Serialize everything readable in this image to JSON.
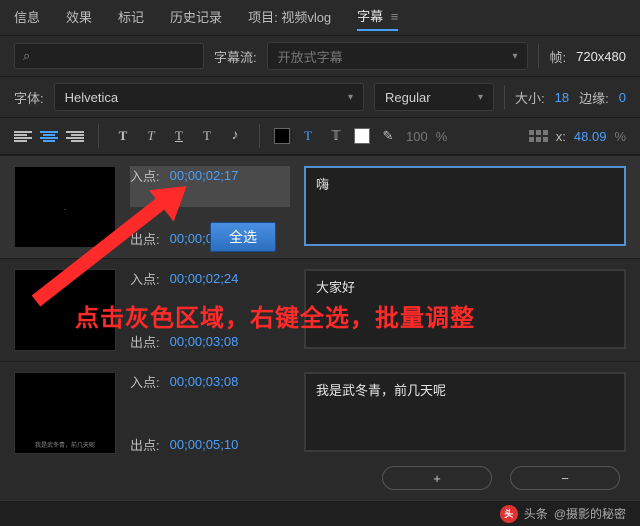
{
  "tabs": {
    "info": "信息",
    "effects": "效果",
    "markers": "标记",
    "history": "历史记录",
    "project_prefix": "项目:",
    "project_name": "视频vlog",
    "captions": "字幕"
  },
  "search": {
    "icon": "⌕"
  },
  "stream_row": {
    "label": "字幕流:",
    "value": "开放式字幕",
    "frame_label": "帧:",
    "frame_value": "720x480"
  },
  "font_row": {
    "label": "字体:",
    "family": "Helvetica",
    "weight": "Regular",
    "size_label": "大小:",
    "size_value": "18",
    "edge_label": "边缘:",
    "edge_value": "0"
  },
  "toolbar": {
    "bold": "T",
    "italic": "T",
    "underline": "T",
    "outline": "T",
    "fill_T": "T",
    "opacity_value": "100",
    "pct": "%",
    "x_label": "x:",
    "x_value": "48.09",
    "x_pct": "%"
  },
  "items": [
    {
      "in_label": "入点:",
      "in_value": "00;00;02;17",
      "out_label": "出点:",
      "out_short": "00;00;02",
      "text": "嗨",
      "thumb_caption": ""
    },
    {
      "in_label": "入点:",
      "in_value": "00;00;02;24",
      "out_label": "出点:",
      "out_value": "00;00;03;08",
      "text": "大家好",
      "thumb_caption": ""
    },
    {
      "in_label": "入点:",
      "in_value": "00;00;03;08",
      "out_label": "出点:",
      "out_value": "00;00;05;10",
      "text": "我是武冬青，前几天呢",
      "thumb_caption": "我是武冬青，前几天呢"
    }
  ],
  "context_menu": {
    "select_all": "全选"
  },
  "annotation": "点击灰色区域，右键全选，批量调整",
  "bottom": {
    "plus": "+",
    "minus": "−"
  },
  "footer": {
    "logo": "头",
    "label": "头条",
    "author": "@摄影的秘密"
  }
}
